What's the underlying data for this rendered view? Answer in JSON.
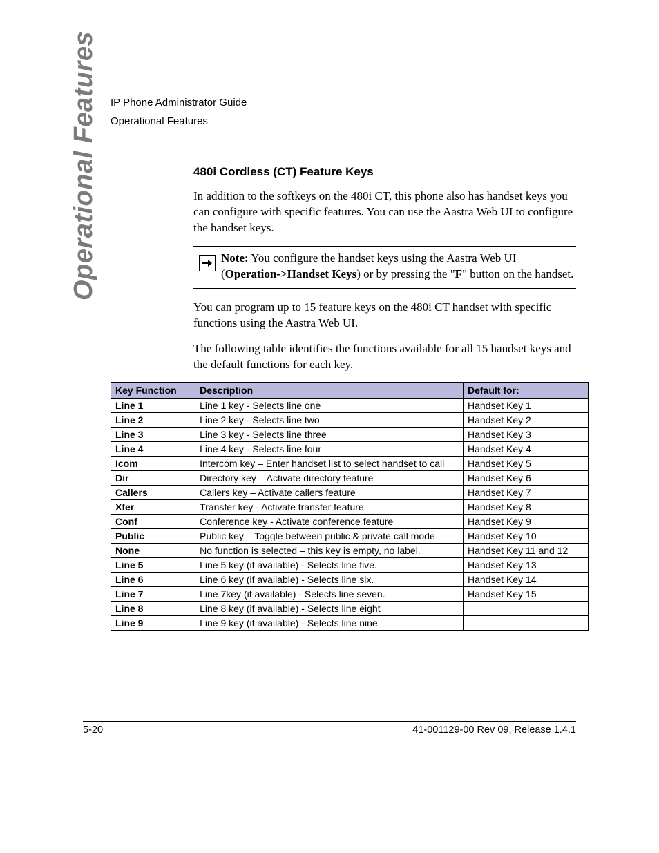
{
  "header": {
    "line1": "IP Phone Administrator Guide",
    "line2": "Operational Features"
  },
  "side_tab": "Operational Features",
  "section": {
    "title": "480i Cordless (CT) Feature Keys",
    "para1": "In addition to the softkeys on the 480i CT, this phone also has handset keys you can configure with specific features. You can use the Aastra Web UI to configure the handset keys.",
    "note": {
      "label": "Note:",
      "t1": " You configure the handset keys using the Aastra Web UI (",
      "path": "Operation->Handset Keys",
      "t2": ") or by pressing the \"",
      "fkey": "F",
      "t3": "\" button on the handset."
    },
    "para2": "You can program up to 15 feature keys on the 480i CT handset with specific functions using the Aastra Web UI.",
    "para3": "The following table identifies the functions available for all 15 handset keys and the default functions for each key."
  },
  "table": {
    "headers": [
      "Key Function",
      "Description",
      "Default for:"
    ],
    "rows": [
      {
        "fn": "Line 1",
        "desc": "Line 1 key - Selects line one",
        "def": "Handset Key 1"
      },
      {
        "fn": "Line 2",
        "desc": "Line 2 key - Selects line two",
        "def": "Handset Key 2"
      },
      {
        "fn": "Line 3",
        "desc": "Line 3 key - Selects line three",
        "def": "Handset Key 3"
      },
      {
        "fn": "Line 4",
        "desc": "Line 4 key - Selects line four",
        "def": "Handset Key 4"
      },
      {
        "fn": "Icom",
        "desc": "Intercom key – Enter handset list to select handset to call",
        "def": "Handset Key 5"
      },
      {
        "fn": "Dir",
        "desc": "Directory key – Activate directory feature",
        "def": "Handset Key 6"
      },
      {
        "fn": "Callers",
        "desc": "Callers key – Activate callers feature",
        "def": "Handset Key 7"
      },
      {
        "fn": "Xfer",
        "desc": "Transfer key - Activate transfer feature",
        "def": "Handset Key 8"
      },
      {
        "fn": "Conf",
        "desc": "Conference key - Activate conference feature",
        "def": "Handset Key 9"
      },
      {
        "fn": "Public",
        "desc": "Public key – Toggle between public & private call mode",
        "def": "Handset Key 10"
      },
      {
        "fn": "None",
        "desc": "No function is selected – this key is empty, no label.",
        "def": "Handset Key 11 and 12"
      },
      {
        "fn": "Line 5",
        "desc": "Line 5 key (if available) - Selects line five.",
        "def": "Handset Key 13"
      },
      {
        "fn": "Line 6",
        "desc": "Line 6 key (if available) - Selects line six.",
        "def": "Handset Key 14"
      },
      {
        "fn": "Line 7",
        "desc": "Line 7key (if available) - Selects line seven.",
        "def": "Handset Key 15"
      },
      {
        "fn": "Line 8",
        "desc": "Line 8 key (if available) - Selects line eight",
        "def": ""
      },
      {
        "fn": "Line 9",
        "desc": "Line 9 key (if available) - Selects line nine",
        "def": ""
      }
    ]
  },
  "footer": {
    "page_num": "5-20",
    "doc_rev": "41-001129-00 Rev 09, Release 1.4.1"
  }
}
